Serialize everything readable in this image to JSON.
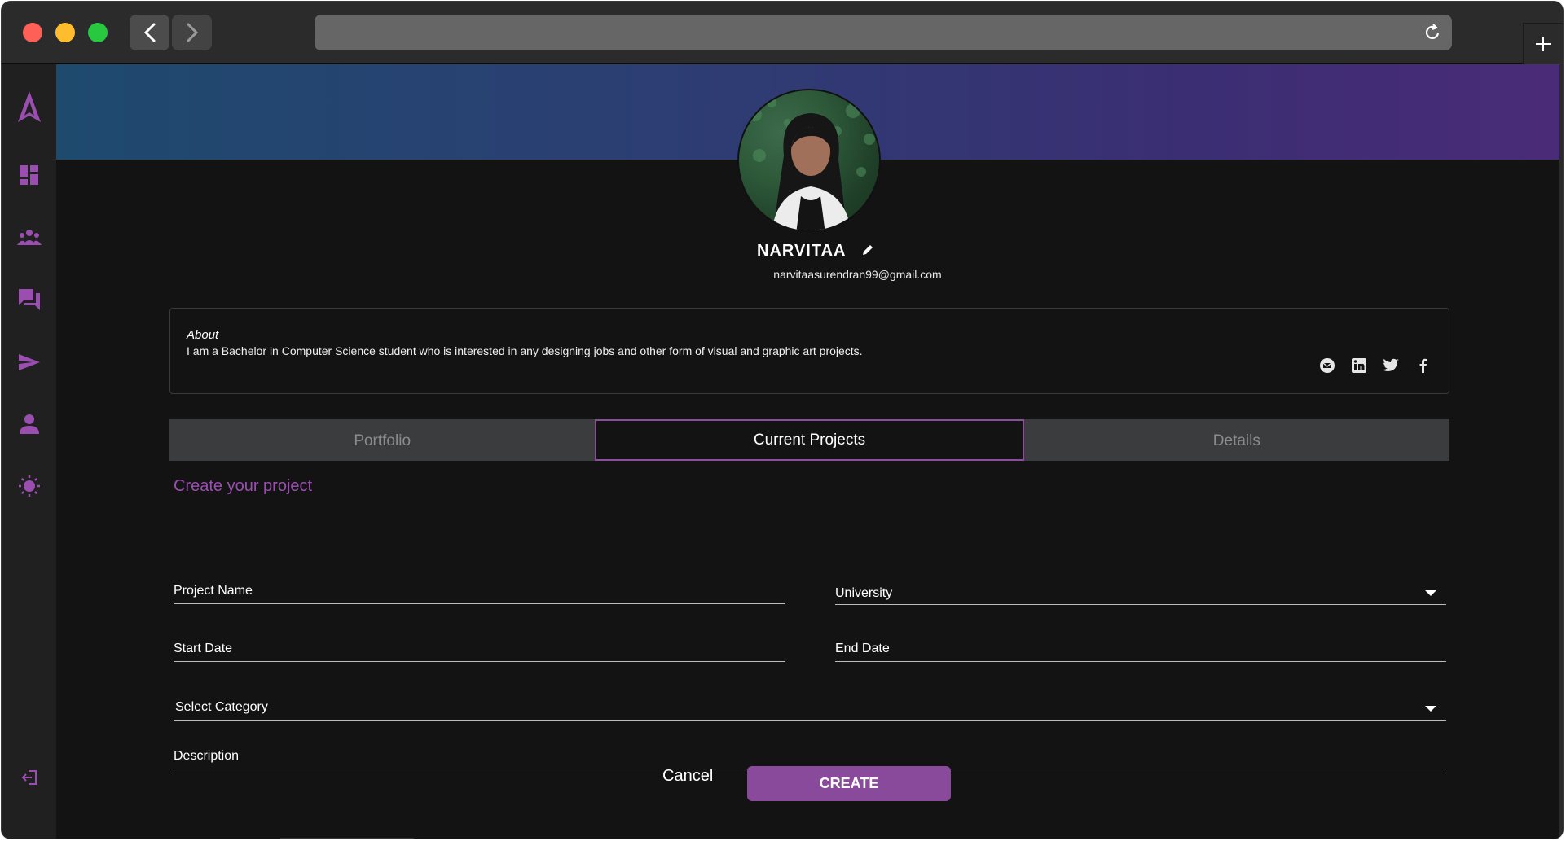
{
  "colors": {
    "accent": "#8a4a9b",
    "accent_text": "#9a4fb0",
    "background": "#131313",
    "sidebar": "#202020",
    "tab_inactive": "#3b3c3d"
  },
  "titlebar": {
    "back_icon": "chevron-left-icon",
    "forward_icon": "chevron-right-icon",
    "reload_icon": "reload-icon",
    "new_tab_icon": "plus-icon"
  },
  "sidebar": {
    "items": [
      {
        "icon": "logo-icon"
      },
      {
        "icon": "dashboard-icon"
      },
      {
        "icon": "groups-icon"
      },
      {
        "icon": "chat-icon"
      },
      {
        "icon": "send-icon"
      },
      {
        "icon": "profile-icon"
      },
      {
        "icon": "theme-sun-icon"
      },
      {
        "icon": "logout-icon"
      }
    ]
  },
  "profile": {
    "name": "NARVITAA",
    "email": "narvitaasurendran99@gmail.com",
    "about_title": "About",
    "about_text": "I am a Bachelor in Computer Science student who is interested in any designing jobs and other form of visual and graphic art projects.",
    "social": [
      "email-icon",
      "linkedin-icon",
      "twitter-icon",
      "facebook-icon"
    ]
  },
  "tabs": [
    {
      "label": "Portfolio",
      "active": false
    },
    {
      "label": "Current Projects",
      "active": true
    },
    {
      "label": "Details",
      "active": false
    }
  ],
  "form": {
    "title": "Create your project",
    "project_name": "Project Name",
    "university": "University",
    "start_date": "Start Date",
    "end_date": "End Date",
    "category": "Select Category",
    "description": "Description",
    "cancel_label": "Cancel",
    "create_label": "CREATE"
  }
}
